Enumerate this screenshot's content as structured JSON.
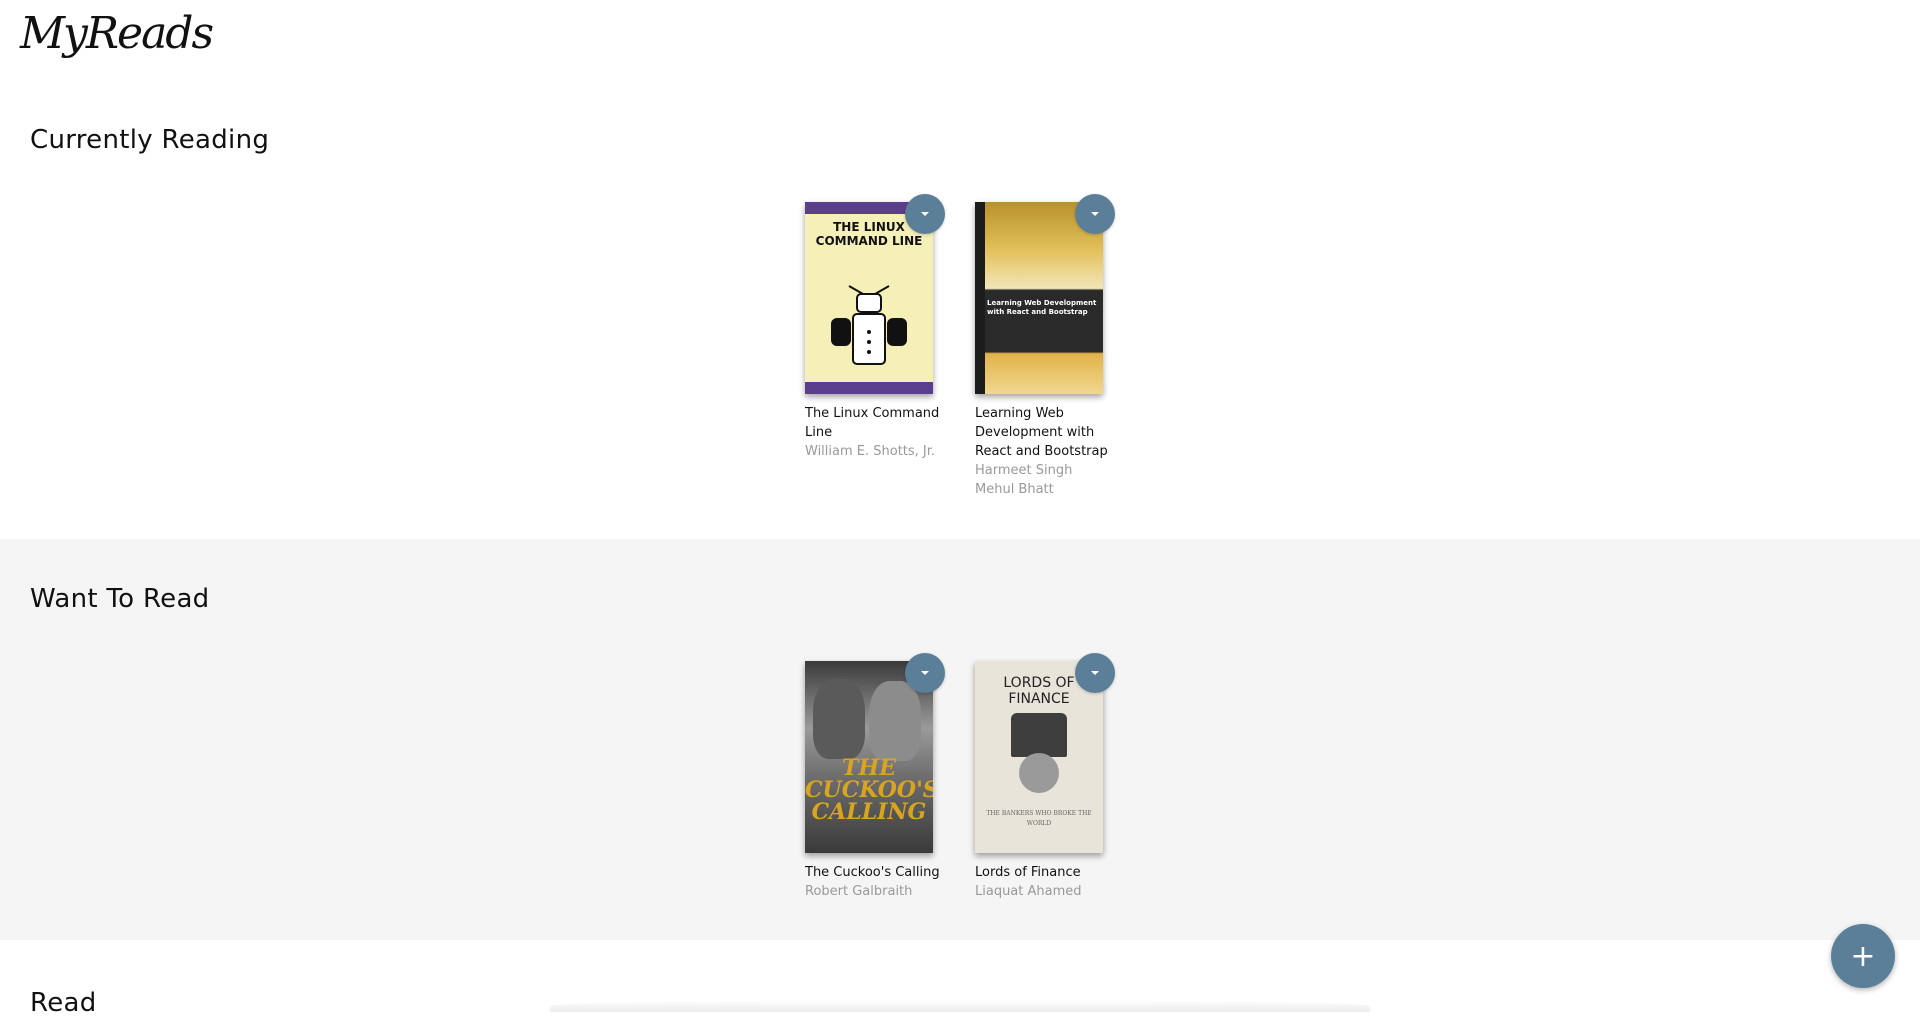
{
  "app": {
    "logo_text": "MyReads"
  },
  "shelves": [
    {
      "title": "Currently Reading",
      "books": [
        {
          "title": "The Linux Command Line",
          "authors": [
            "William E. Shotts, Jr."
          ],
          "cover_text": "THE LINUX COMMAND LINE"
        },
        {
          "title": "Learning Web Development with React and Bootstrap",
          "authors": [
            "Harmeet Singh",
            "Mehul Bhatt"
          ],
          "cover_text": "Learning Web Development with React and Bootstrap"
        }
      ]
    },
    {
      "title": "Want To Read",
      "books": [
        {
          "title": "The Cuckoo's Calling",
          "authors": [
            "Robert Galbraith"
          ],
          "cover_text": "THE CUCKOO'S CALLING"
        },
        {
          "title": "Lords of Finance",
          "authors": [
            "Liaquat Ahamed"
          ],
          "cover_text": "LORDS OF FINANCE",
          "cover_subtext": "THE BANKERS WHO BROKE THE WORLD"
        }
      ]
    },
    {
      "title": "Read",
      "books": []
    }
  ],
  "fab": {
    "label": "+"
  },
  "icons": {
    "shelf_changer": "caret-down-icon",
    "add": "plus-icon"
  },
  "colors": {
    "accent": "#5b7f98",
    "shelf_alt_bg": "#f5f5f5",
    "author_text": "#999999"
  }
}
